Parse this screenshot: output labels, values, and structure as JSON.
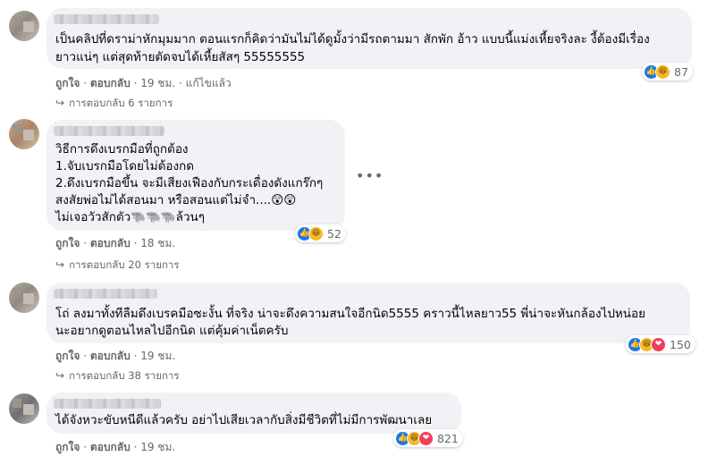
{
  "comments": [
    {
      "lines": [
        "เป็นคลิปที่ดราม่าหักมุมมาก ตอนแรกก็คิดว่ามันไม่ได้ดูมั้งว่ามีรถตามมา สักพัก อ้าว แบบนี้แม่งเหี้ยจริงละ งี้ต้องมีเรื่อง",
        "ยาวแน่ๆ แต่สุดท้ายตัดจบได้เหี้ยสัสๆ 55555555"
      ],
      "reaction_icons": [
        "like-icon",
        "haha-icon"
      ],
      "reaction_count": "87",
      "like_label": "ถูกใจ",
      "reply_label": "ตอบกลับ",
      "time": "19 ชม.",
      "edited_label": "แก้ไขแล้ว",
      "replies_label": "การตอบกลับ 6 รายการ"
    },
    {
      "lines": [
        "วิธีการดึงเบรกมือที่ถูกต้อง",
        "1.จับเบรกมือโดยไม่ต้องกด",
        "2.ดึงเบรกมือขึ้น จะมีเสียงเฟืองกับกระเดื่องดังแกร๊กๆ",
        "สงสัยพ่อไม่ได้สอนมา หรือสอนแต่ไม่จำ....😲😲",
        "ไม่เจอวัวสักตัว🐃🐃🐃ล้วนๆ"
      ],
      "reaction_icons": [
        "like-icon",
        "haha-icon"
      ],
      "reaction_count": "52",
      "like_label": "ถูกใจ",
      "reply_label": "ตอบกลับ",
      "time": "18 ชม.",
      "replies_label": "การตอบกลับ 20 รายการ"
    },
    {
      "lines": [
        "โถ่ ลงมาทั้งทีลืมดึงเบรคมือซะงั้น ที่จริง น่าจะดึงความสนใจอีกนิด5555 คราวนี้ไหลยาว55 พี่น่าจะหันกล้องไปหน่อย",
        "นะอยากดูตอนไหลไปอีกนิด แต่คุ้มค่าเน็ตครับ"
      ],
      "reaction_icons": [
        "like-icon",
        "haha-icon",
        "love-icon"
      ],
      "reaction_count": "150",
      "like_label": "ถูกใจ",
      "reply_label": "ตอบกลับ",
      "time": "19 ชม.",
      "replies_label": "การตอบกลับ 38 รายการ"
    },
    {
      "lines": [
        "ได้จังหวะขับหนีดีแล้วครับ อย่าไปเสียเวลากับสิ่งมีชีวิตที่ไม่มีการพัฒนาเลย"
      ],
      "reaction_icons": [
        "like-icon",
        "haha-icon",
        "love-icon"
      ],
      "reaction_count": "821",
      "like_label": "ถูกใจ",
      "reply_label": "ตอบกลับ",
      "time": "19 ชม."
    }
  ],
  "more_options_glyph": "•••",
  "reply_arrow_glyph": "↪",
  "reaction_glyphs": {
    "like": "👍",
    "haha": "😆",
    "love": "❤"
  },
  "colors": {
    "bubble": "#f0f2f5",
    "meta_text": "#65676b",
    "like": "#1877f2",
    "haha": "#f7b928",
    "love": "#f33e58"
  }
}
